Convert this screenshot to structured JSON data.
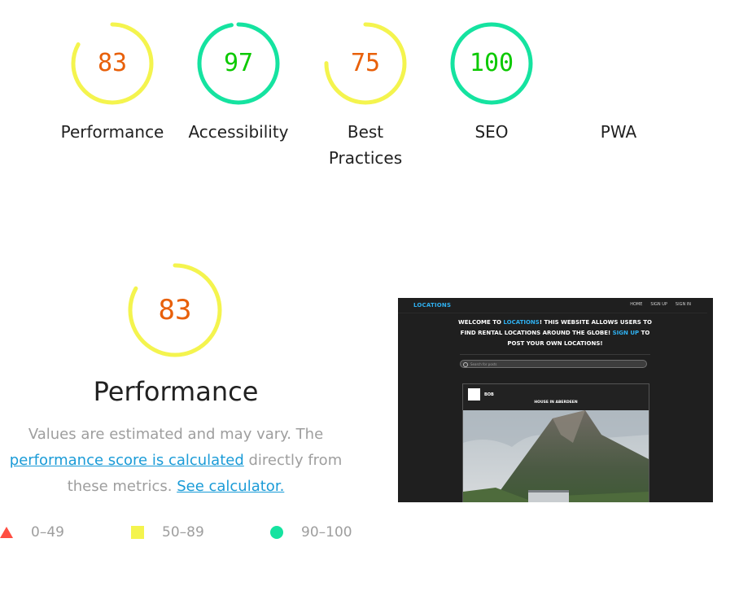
{
  "categories": [
    {
      "score": "83",
      "label": "Performance",
      "fraction": 0.83,
      "color": "#f4f44e",
      "text_color": "#e8600a"
    },
    {
      "score": "97",
      "label": "Accessibility",
      "fraction": 0.97,
      "color": "#15e3a0",
      "text_color": "#0cc900"
    },
    {
      "score": "75",
      "label": "Best Practices",
      "fraction": 0.75,
      "color": "#f4f44e",
      "text_color": "#e8600a"
    },
    {
      "score": "100",
      "label": "SEO",
      "fraction": 1.0,
      "color": "#15e3a0",
      "text_color": "#0cc900"
    },
    {
      "score": "",
      "label": "PWA",
      "fraction": 0,
      "color": "",
      "text_color": ""
    }
  ],
  "performance": {
    "score": "83",
    "fraction": 0.83,
    "title": "Performance",
    "desc_before": "Values are estimated and may vary. The ",
    "desc_link1": "performance score is calculated",
    "desc_middle": " directly from these metrics. ",
    "desc_link2": "See calculator."
  },
  "legend": [
    {
      "range": "0–49",
      "shape": "triangle",
      "color": "#ff4e42"
    },
    {
      "range": "50–89",
      "shape": "square",
      "color": "#f4f44e"
    },
    {
      "range": "90–100",
      "shape": "circle",
      "color": "#15e3a0"
    }
  ],
  "thumbnail": {
    "brand": "LOCATIONS",
    "nav": [
      "HOME",
      "SIGN UP",
      "SIGN IN"
    ],
    "welcome_1": "WELCOME TO ",
    "welcome_hl1": "LOCATIONS",
    "welcome_2": "! THIS WEBSITE ALLOWS USERS TO FIND RENTAL LOCATIONS AROUND THE GLOBE! ",
    "welcome_hl2": "SIGN UP",
    "welcome_3": " TO POST YOUR OWN LOCATIONS!",
    "search_placeholder": "Search for posts",
    "card_user": "BOB",
    "card_title": "HOUSE IN ABERDEEN"
  }
}
